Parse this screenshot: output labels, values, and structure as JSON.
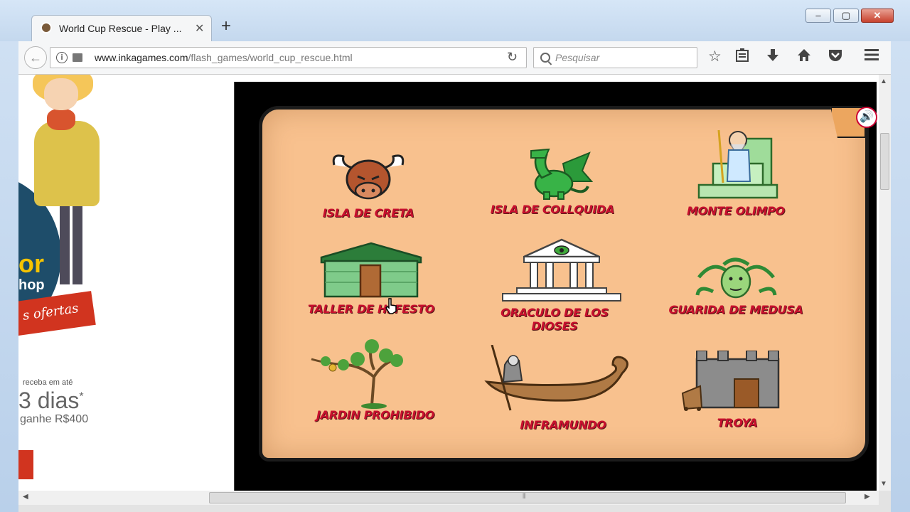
{
  "browser": {
    "tab_title": "World Cup Rescue - Play ...",
    "tab_close": "✕",
    "new_tab": "+",
    "url_host": "www.inkagames.com",
    "url_path": "/flash_games/world_cup_rescue.html",
    "search_placeholder": "Pesquisar",
    "window": {
      "minimize": "–",
      "maximize": "▢",
      "close": "✕"
    },
    "toolbar_icons": [
      "star-icon",
      "reading-list-icon",
      "download-icon",
      "home-icon",
      "pocket-icon",
      "menu-icon"
    ]
  },
  "ad": {
    "headline": "or",
    "shop": "hop",
    "banner": "s ofertas",
    "small": "receba em até",
    "days": "3 dias",
    "days_mark": "*",
    "ganhe": "ganhe R$400"
  },
  "game": {
    "locations": [
      {
        "label": "ISLA DE CRETA",
        "icon": "bull-icon"
      },
      {
        "label": "ISLA DE COLLQUIDA",
        "icon": "dragon-icon"
      },
      {
        "label": "MONTE OLIMPO",
        "icon": "zeus-throne-icon"
      },
      {
        "label": "TALLER DE HEFESTO",
        "icon": "workshop-hut-icon"
      },
      {
        "label": "ORACULO DE LOS DIOSES",
        "icon": "temple-icon"
      },
      {
        "label": "GUARIDA DE MEDUSA",
        "icon": "medusa-icon"
      },
      {
        "label": "JARDIN PROHIBIDO",
        "icon": "tree-icon"
      },
      {
        "label": "INFRAMUNDO",
        "icon": "ferry-boat-icon"
      },
      {
        "label": "TROYA",
        "icon": "castle-icon"
      }
    ]
  },
  "colors": {
    "parchment": "#f8c18e",
    "label_red": "#c8102e",
    "game_bg": "#000000"
  }
}
